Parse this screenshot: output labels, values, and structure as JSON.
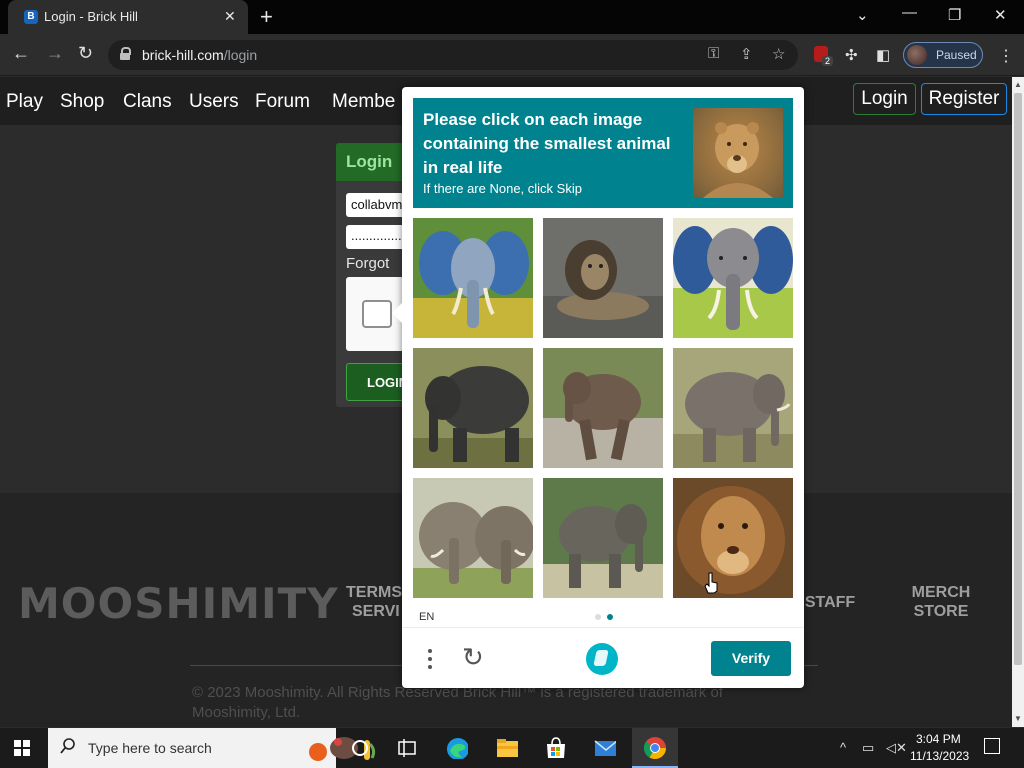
{
  "browser": {
    "tab_title": "Login - Brick Hill",
    "tab_favicon": "B",
    "url_host": "brick-hill.com",
    "url_path": "/login",
    "profile_label": "Paused",
    "ublock_badge": "2"
  },
  "site": {
    "nav": [
      "Play",
      "Shop",
      "Clans",
      "Users",
      "Forum",
      "Membe"
    ],
    "login_label": "Login",
    "register_label": "Register"
  },
  "login_form": {
    "heading": "Login",
    "username_value": "collabvm",
    "password_value": "..............",
    "forgot_label": "Forgot",
    "submit_label": "LOGIN"
  },
  "footer": {
    "logo": "MOOSHIMITY",
    "terms_line1": "TERMS",
    "terms_line2": "SERVI",
    "staff": "STAFF",
    "merch_line1": "MERCH",
    "merch_line2": "STORE",
    "copyright_line1": "© 2023 Mooshimity. All Rights Reserved Brick Hill™ is a registered trademark of",
    "copyright_line2": "Mooshimity, Ltd."
  },
  "challenge": {
    "prompt": "Please click on each image containing the smallest animal in real life",
    "subprompt": "If there are None, click Skip",
    "sample_image": "lioness",
    "tiles": [
      {
        "subject": "painted elephant"
      },
      {
        "subject": "lion lying"
      },
      {
        "subject": "painted elephant face"
      },
      {
        "subject": "elephant"
      },
      {
        "subject": "elephant calf"
      },
      {
        "subject": "elephant"
      },
      {
        "subject": "two elephants"
      },
      {
        "subject": "elephant walking"
      },
      {
        "subject": "lion face"
      }
    ],
    "language": "EN",
    "verify_label": "Verify",
    "accent": "#00838f"
  },
  "taskbar": {
    "search_placeholder": "Type here to search",
    "time": "3:04 PM",
    "date": "11/13/2023"
  }
}
